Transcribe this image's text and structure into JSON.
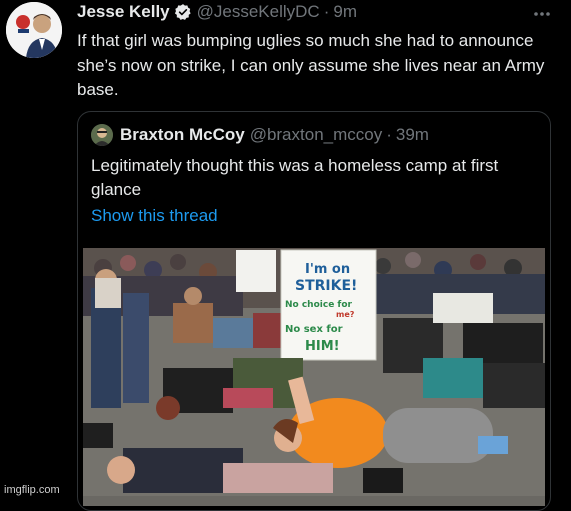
{
  "tweet": {
    "author_name": "Jesse Kelly",
    "author_handle": "@JesseKellyDC",
    "separator": "·",
    "time": "9m",
    "text": "If that girl was bumping uglies so much she had to announce she’s now on strike, I can only assume she lives near an Army base.",
    "more_icon": "more-horizontal-icon",
    "verified_icon": "verified-badge-icon",
    "colors": {
      "text": "#e7e9ea",
      "muted": "#71767b",
      "link": "#1d9bf0",
      "verified": "#1d9bf0"
    }
  },
  "quoted": {
    "author_name": "Braxton McCoy",
    "author_handle": "@braxton_mccoy",
    "separator": "·",
    "time": "39m",
    "text": "Legitimately thought this was a homeless camp at first glance",
    "show_thread": "Show this thread"
  },
  "photo": {
    "sign": {
      "line1": "I'm on",
      "line2": "STRIKE!",
      "line3": "No choice for",
      "line4": "me?",
      "line5": "No sex for",
      "line6": "HIM!"
    }
  },
  "watermark": "imgflip.com"
}
